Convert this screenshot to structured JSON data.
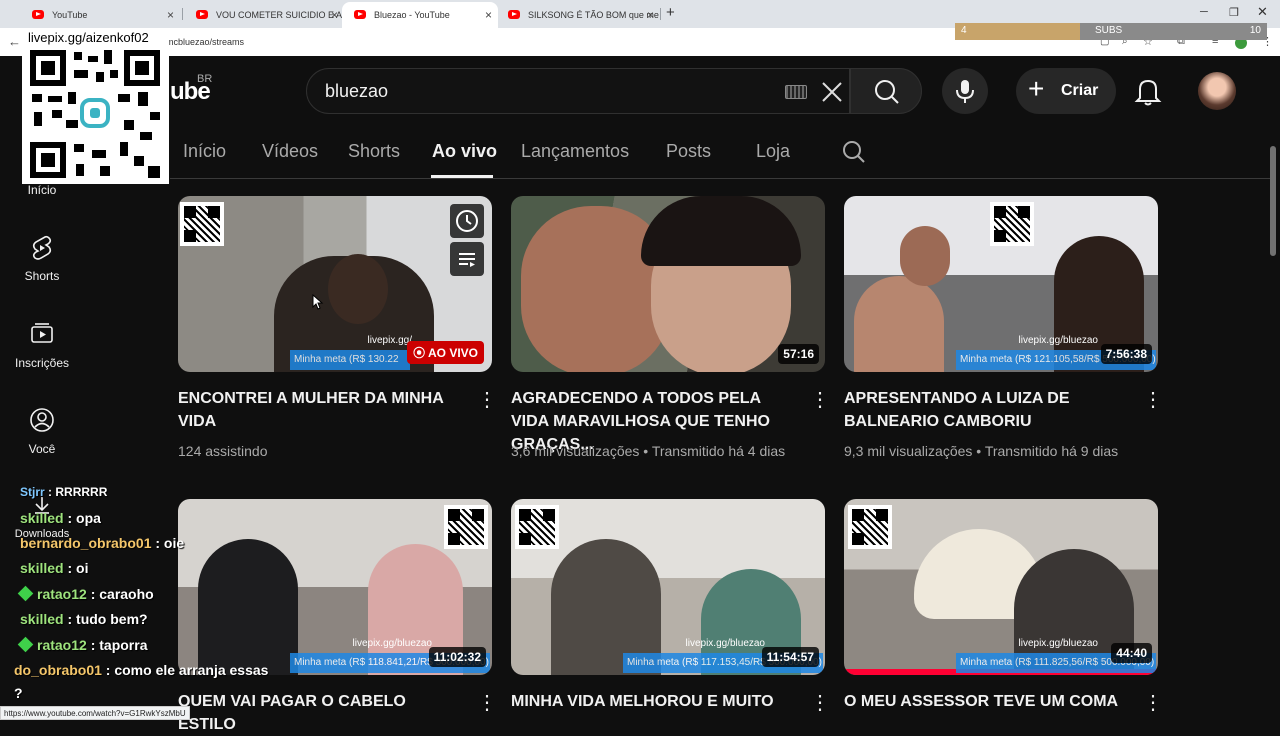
{
  "browser": {
    "tabs": [
      {
        "title": "YouTube"
      },
      {
        "title": "VOU COMETER SUICIDIO E A C"
      },
      {
        "title": "Bluezao - YouTube"
      },
      {
        "title": "SILKSONG É TÃO BOM que me"
      }
    ],
    "new_tab_symbol": "+",
    "url": "mcbluezao/streams",
    "status_url": "https://www.youtube.com/watch?v=G1RwkYszMbU"
  },
  "subs_overlay": {
    "left": "4",
    "label": "SUBS",
    "right": "10",
    "progress": 0.4
  },
  "qr_overlay": {
    "text": "livepix.gg/aizenkof02"
  },
  "header": {
    "logo_text": "ube",
    "region": "BR",
    "search_value": "bluezao",
    "create_label": "Criar"
  },
  "channel_tabs": [
    {
      "label": "Início"
    },
    {
      "label": "Vídeos"
    },
    {
      "label": "Shorts"
    },
    {
      "label": "Ao vivo"
    },
    {
      "label": "Lançamentos"
    },
    {
      "label": "Posts"
    },
    {
      "label": "Loja"
    }
  ],
  "left_nav": [
    {
      "label": "Início"
    },
    {
      "label": "Shorts"
    },
    {
      "label": "Inscrições"
    },
    {
      "label": "Você"
    },
    {
      "label": "Downloads"
    }
  ],
  "videos": [
    {
      "title": "ENCONTREI A MULHER DA MINHA VIDA",
      "meta": "124 assistindo",
      "badge": "AO VIVO",
      "thumb_meta": "Minha meta (R$ 130.22",
      "thumb_site": "livepix.gg/"
    },
    {
      "title": "AGRADECENDO A TODOS PELA VIDA MARAVILHOSA QUE TENHO GRAÇAS...",
      "meta": "3,6 mil visualizações • Transmitido há 4 dias",
      "duration": "57:16"
    },
    {
      "title": "APRESENTANDO A LUIZA DE BALNEARIO CAMBORIU",
      "meta": "9,3 mil visualizações • Transmitido há 9 dias",
      "duration": "7:56:38",
      "thumb_meta": "Minha meta (R$ 121.105,58/R$ 500.000,00)",
      "thumb_site": "livepix.gg/bluezao"
    },
    {
      "title": "QUEM VAI PAGAR O CABELO ESTILO",
      "duration": "11:02:32",
      "thumb_meta": "Minha meta (R$ 118.841,21/R$ 500.000,00)",
      "thumb_site": "livepix.gg/bluezao"
    },
    {
      "title": "MINHA VIDA MELHOROU E MUITO",
      "duration": "11:54:57",
      "thumb_meta": "Minha meta (R$ 117.153,45/R$ 500.000,00)",
      "thumb_site": "livepix.gg/bluezao"
    },
    {
      "title": "O MEU ASSESSOR TEVE UM COMA",
      "duration": "44:40",
      "thumb_meta": "Minha meta (R$ 111.825,56/R$ 500.000,00)",
      "thumb_site": "livepix.gg/bluezao"
    }
  ],
  "chat": [
    {
      "user": "Stjrr",
      "msg": ": RRRRRR"
    },
    {
      "user": "skilled",
      "msg": ": opa"
    },
    {
      "user": "bernardo_obrabo01",
      "msg": ": oie"
    },
    {
      "user": "skilled",
      "msg": ": oi"
    },
    {
      "user": "ratao12",
      "msg": ": caraoho"
    },
    {
      "user": "skilled",
      "msg": ": tudo bem?"
    },
    {
      "user": "ratao12",
      "msg": ": taporra"
    },
    {
      "user": "do_obrabo01",
      "msg": ": como ele arranja essas"
    },
    {
      "user": "",
      "msg": "?"
    }
  ],
  "colors": {
    "background": "#0f0f0f",
    "live": "#cc0000",
    "text_secondary": "#aaaaaa"
  }
}
